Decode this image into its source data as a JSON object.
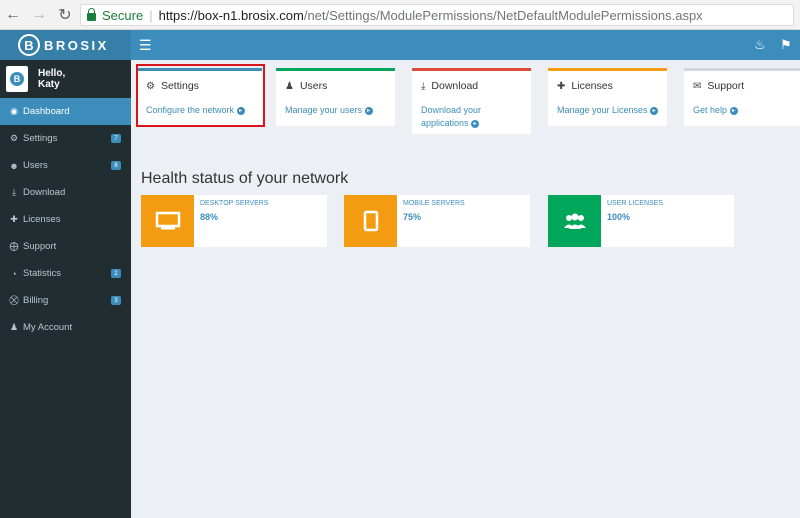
{
  "browser": {
    "secure_label": "Secure",
    "url_host": "https://box-n1.brosix.com",
    "url_path": "/net/Settings/ModulePermissions/NetDefaultModulePermissions.aspx"
  },
  "app": {
    "logo_text": "BROSIX",
    "logo_letter": "B"
  },
  "user": {
    "greeting": "Hello,",
    "name": "Katy",
    "avatar_text": "BROSIX"
  },
  "sidebar": {
    "items": [
      {
        "label": "Dashboard",
        "icon": "dashboard-icon",
        "badge": ""
      },
      {
        "label": "Settings",
        "icon": "gears-icon",
        "badge": "7"
      },
      {
        "label": "Users",
        "icon": "users-icon",
        "badge": "8"
      },
      {
        "label": "Download",
        "icon": "download-icon",
        "badge": ""
      },
      {
        "label": "Licenses",
        "icon": "user-plus-icon",
        "badge": ""
      },
      {
        "label": "Support",
        "icon": "lifebuoy-icon",
        "badge": ""
      },
      {
        "label": "Statistics",
        "icon": "pie-chart-icon",
        "badge": "2"
      },
      {
        "label": "Billing",
        "icon": "bank-icon",
        "badge": "3"
      },
      {
        "label": "My Account",
        "icon": "user-icon",
        "badge": ""
      }
    ]
  },
  "cards": [
    {
      "title": "Settings",
      "link": "Configure the network",
      "color": "#3c8dbc"
    },
    {
      "title": "Users",
      "link": "Manage your users",
      "color": "#00a65a"
    },
    {
      "title": "Download",
      "link": "Download your applications",
      "color": "#dd4b39"
    },
    {
      "title": "Licenses",
      "link": "Manage your Licenses",
      "color": "#f39c12"
    },
    {
      "title": "Support",
      "link": "Get help",
      "color": "#d2d6de"
    }
  ],
  "health": {
    "title": "Health status of your network",
    "boxes": [
      {
        "label": "DESKTOP SERVERS",
        "value": "88%",
        "color": "#f39c12"
      },
      {
        "label": "MOBILE SERVERS",
        "value": "75%",
        "color": "#f39c12"
      },
      {
        "label": "USER LICENSES",
        "value": "100%",
        "color": "#00a65a"
      }
    ]
  }
}
